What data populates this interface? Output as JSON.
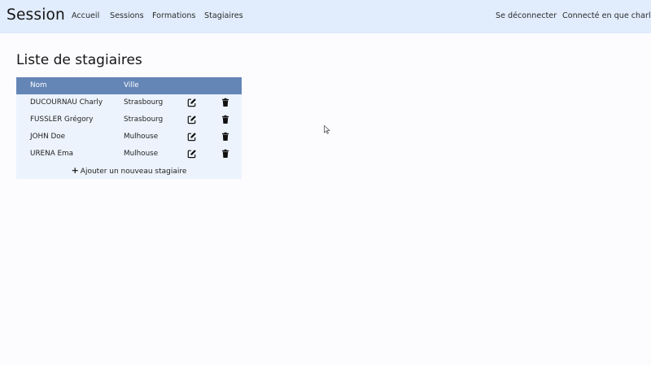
{
  "navbar": {
    "brand": "Session",
    "links": [
      "Accueil",
      "Sessions",
      "Formations",
      "Stagiaires"
    ],
    "logout": "Se déconnecter",
    "user_status": "Connecté en que charly"
  },
  "page": {
    "title": "Liste de stagiaires"
  },
  "table": {
    "columns": [
      "Nom",
      "Ville"
    ],
    "rows": [
      {
        "name": "DUCOURNAU Charly",
        "city": "Strasbourg"
      },
      {
        "name": "FUSSLER Grégory",
        "city": "Strasbourg"
      },
      {
        "name": "JOHN Doe",
        "city": "Mulhouse"
      },
      {
        "name": "URENA Ema",
        "city": "Mulhouse"
      }
    ],
    "row_icons": [
      "edit-icon",
      "trash-icon"
    ],
    "add_label": "Ajouter un nouveau stagiaire",
    "add_icon": "plus-icon"
  },
  "colors": {
    "navbar_bg": "#e1ecfc",
    "table_header_bg": "#6486b7",
    "table_body_bg": "#ecf3fc",
    "page_bg": "#fcfbfe"
  }
}
